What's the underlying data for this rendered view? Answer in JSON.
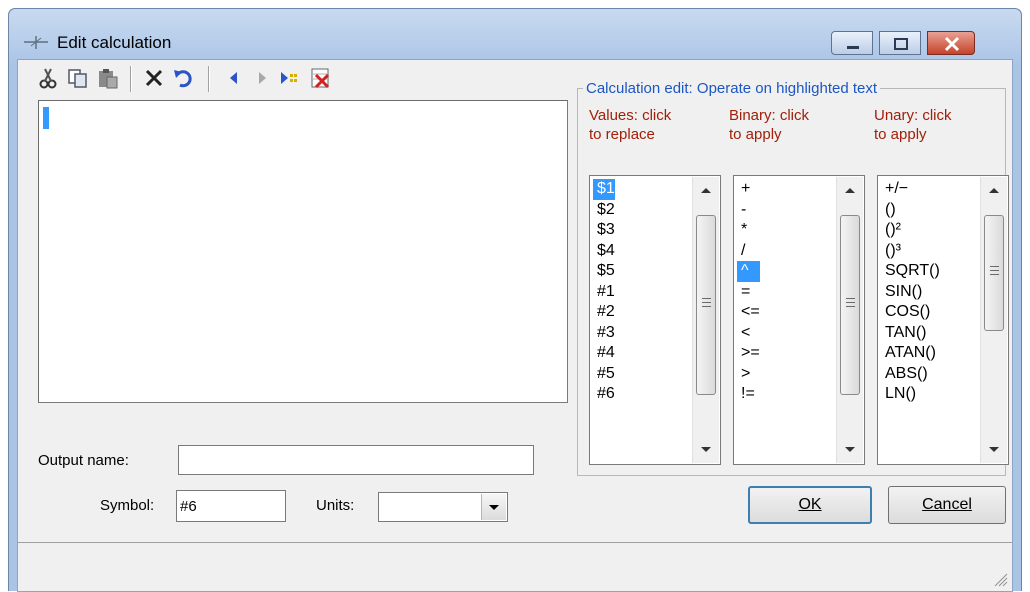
{
  "window": {
    "title": "Edit calculation"
  },
  "toolbar": {
    "items": [
      "cut-icon",
      "copy-icon",
      "paste-icon",
      "delete-icon",
      "undo-icon",
      "move-left-icon",
      "move-right-icon",
      "insert-icon",
      "clear-icon"
    ]
  },
  "group": {
    "title": "Calculation edit: Operate on highlighted text",
    "values": {
      "heading_line1": "Values: click",
      "heading_line2": "to replace",
      "items": [
        "$1",
        "$2",
        "$3",
        "$4",
        "$5",
        "#1",
        "#2",
        "#3",
        "#4",
        "#5",
        "#6"
      ],
      "selected": 0
    },
    "binary": {
      "heading_line1": "Binary: click",
      "heading_line2": "to apply",
      "items": [
        "+",
        "-",
        "*",
        "/",
        "^",
        "=",
        "<=",
        "<",
        ">=",
        ">",
        "!="
      ],
      "selected": 4
    },
    "unary": {
      "heading_line1": "Unary: click",
      "heading_line2": "to apply",
      "items": [
        "+/−",
        "()",
        "()²",
        "()³",
        "SQRT()",
        "SIN()",
        "COS()",
        "TAN()",
        "ATAN()",
        "ABS()",
        "LN()"
      ],
      "selected": -1
    }
  },
  "form": {
    "output_name_label": "Output name:",
    "output_name_value": "",
    "symbol_label": "Symbol:",
    "symbol_value": "#6",
    "units_label": "Units:",
    "units_value": ""
  },
  "buttons": {
    "ok": "OK",
    "cancel": "Cancel"
  },
  "colors": {
    "accent": "#3399ff",
    "group_title": "#1c56c2",
    "column_heading": "#a0200a"
  }
}
